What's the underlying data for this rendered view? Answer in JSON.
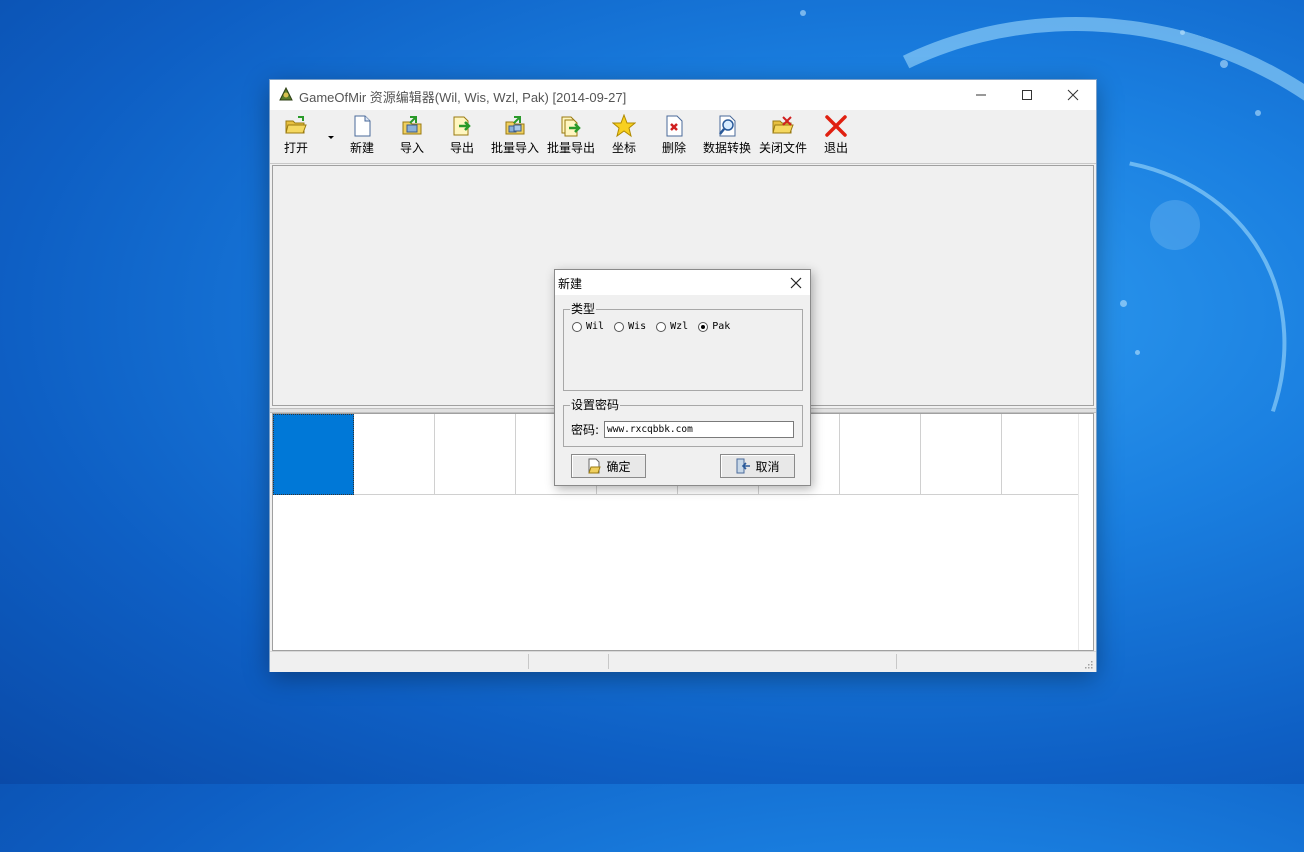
{
  "window": {
    "title": "GameOfMir 资源编辑器(Wil, Wis, Wzl, Pak) [2014-09-27]",
    "controls": [
      "minimize",
      "maximize",
      "close"
    ]
  },
  "toolbar": {
    "items": [
      {
        "label": "打开",
        "icon": "folder-open-icon"
      },
      {
        "label": "新建",
        "icon": "new-file-icon"
      },
      {
        "label": "导入",
        "icon": "import-icon"
      },
      {
        "label": "导出",
        "icon": "export-icon"
      },
      {
        "label": "批量导入",
        "icon": "batch-import-icon"
      },
      {
        "label": "批量导出",
        "icon": "batch-export-icon"
      },
      {
        "label": "坐标",
        "icon": "star-icon"
      },
      {
        "label": "删除",
        "icon": "delete-icon"
      },
      {
        "label": "数据转换",
        "icon": "convert-icon"
      },
      {
        "label": "关闭文件",
        "icon": "close-file-icon"
      },
      {
        "label": "退出",
        "icon": "exit-icon"
      }
    ]
  },
  "dialog": {
    "title": "新建",
    "type_group": {
      "legend": "类型",
      "options": [
        "Wil",
        "Wis",
        "Wzl",
        "Pak"
      ],
      "selected": "Pak"
    },
    "password_group": {
      "legend": "设置密码",
      "label": "密码:",
      "value": "www.rxcqbbk.com"
    },
    "ok_label": "确定",
    "cancel_label": "取消"
  },
  "colors": {
    "desktop": "#1a7fe0",
    "selected_cell": "#0078d7",
    "window_bg": "#f0f0f0"
  }
}
